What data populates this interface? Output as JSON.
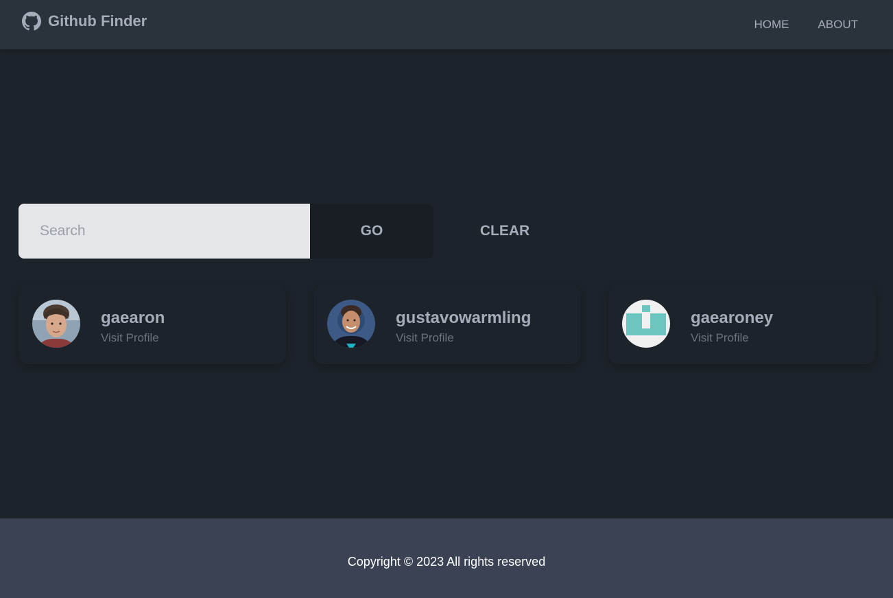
{
  "navbar": {
    "brand": "Github Finder",
    "brand_icon": "github-icon",
    "links": [
      "HOME",
      "ABOUT"
    ]
  },
  "search": {
    "placeholder": "Search",
    "value": "",
    "go_label": "GO",
    "clear_label": "CLEAR"
  },
  "results": [
    {
      "login": "gaearon",
      "link_label": "Visit Profile",
      "avatar": "photo-avatar"
    },
    {
      "login": "gustavowarmling",
      "link_label": "Visit Profile",
      "avatar": "photo-avatar"
    },
    {
      "login": "gaearoney",
      "link_label": "Visit Profile",
      "avatar": "identicon-avatar"
    }
  ],
  "footer": {
    "copyright": "Copyright © 2023 All rights reserved"
  },
  "colors": {
    "background": "#1d232a",
    "navbar": "#2a323c",
    "footer": "#3a4253",
    "text": "#a6adba",
    "identicon": "#6cc5bf"
  }
}
